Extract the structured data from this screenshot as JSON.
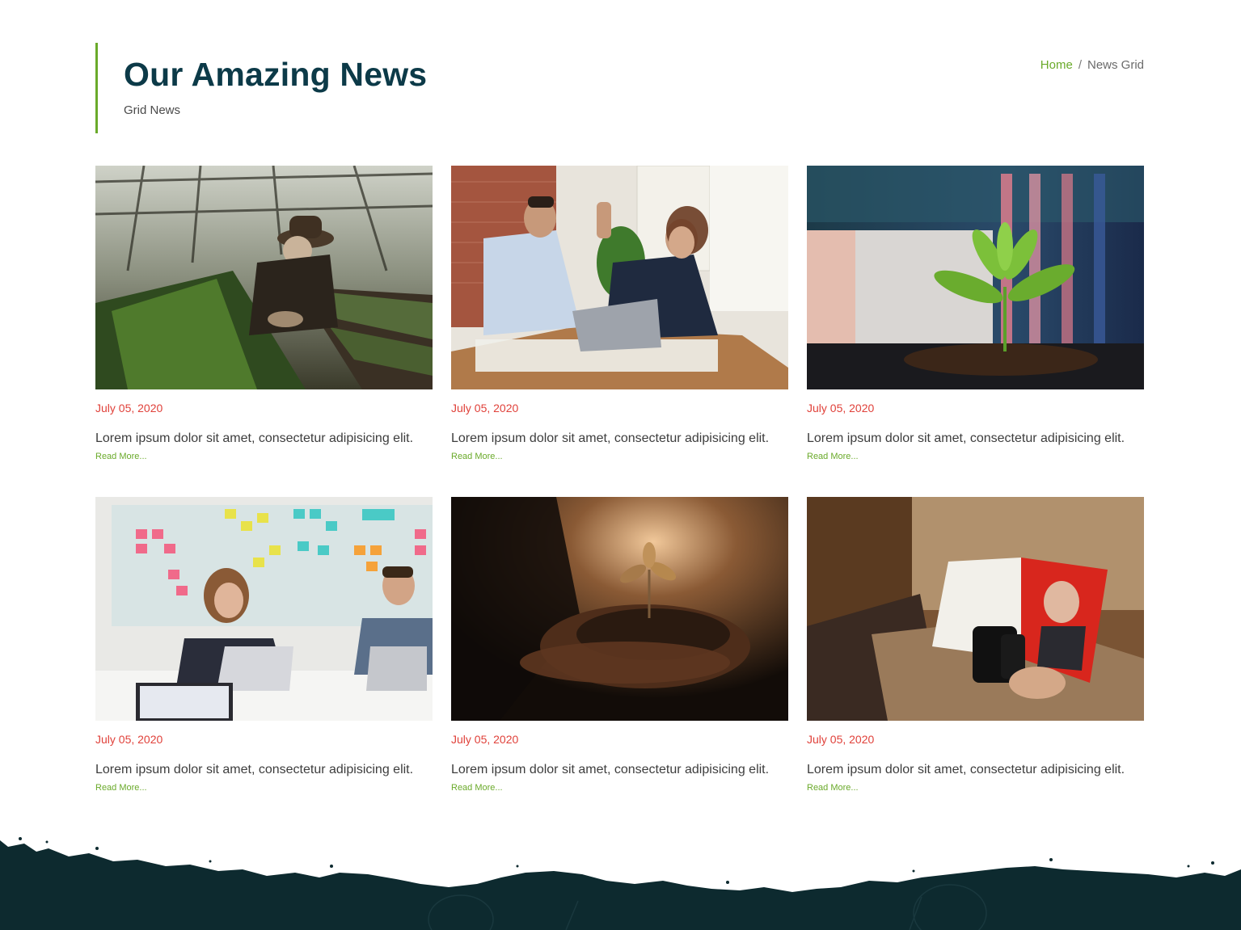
{
  "header": {
    "title": "Our Amazing News",
    "subtitle": "Grid News"
  },
  "breadcrumb": {
    "home": "Home",
    "separator": "/",
    "current": "News Grid"
  },
  "colors": {
    "accent_green": "#6aaa2a",
    "title_navy": "#0c3a48",
    "date_red": "#e0413a",
    "footer_dark": "#0d2a2f"
  },
  "news": [
    {
      "image": "farmer-in-greenhouse",
      "date": "July 05, 2020",
      "excerpt": "Lorem ipsum dolor sit amet, consectetur adipisicing elit.",
      "read_more": "Read More..."
    },
    {
      "image": "business-high-five",
      "date": "July 05, 2020",
      "excerpt": "Lorem ipsum dolor sit amet, consectetur adipisicing elit.",
      "read_more": "Read More..."
    },
    {
      "image": "sprout-in-soil-city",
      "date": "July 05, 2020",
      "excerpt": "Lorem ipsum dolor sit amet, consectetur adipisicing elit.",
      "read_more": "Read More..."
    },
    {
      "image": "team-meeting-sticky-notes",
      "date": "July 05, 2020",
      "excerpt": "Lorem ipsum dolor sit amet, consectetur adipisicing elit.",
      "read_more": "Read More..."
    },
    {
      "image": "hands-holding-seedling",
      "date": "July 05, 2020",
      "excerpt": "Lorem ipsum dolor sit amet, consectetur adipisicing elit.",
      "read_more": "Read More..."
    },
    {
      "image": "reading-business-magazine",
      "date": "July 05, 2020",
      "excerpt": "Lorem ipsum dolor sit amet, consectetur adipisicing elit.",
      "read_more": "Read More..."
    }
  ]
}
